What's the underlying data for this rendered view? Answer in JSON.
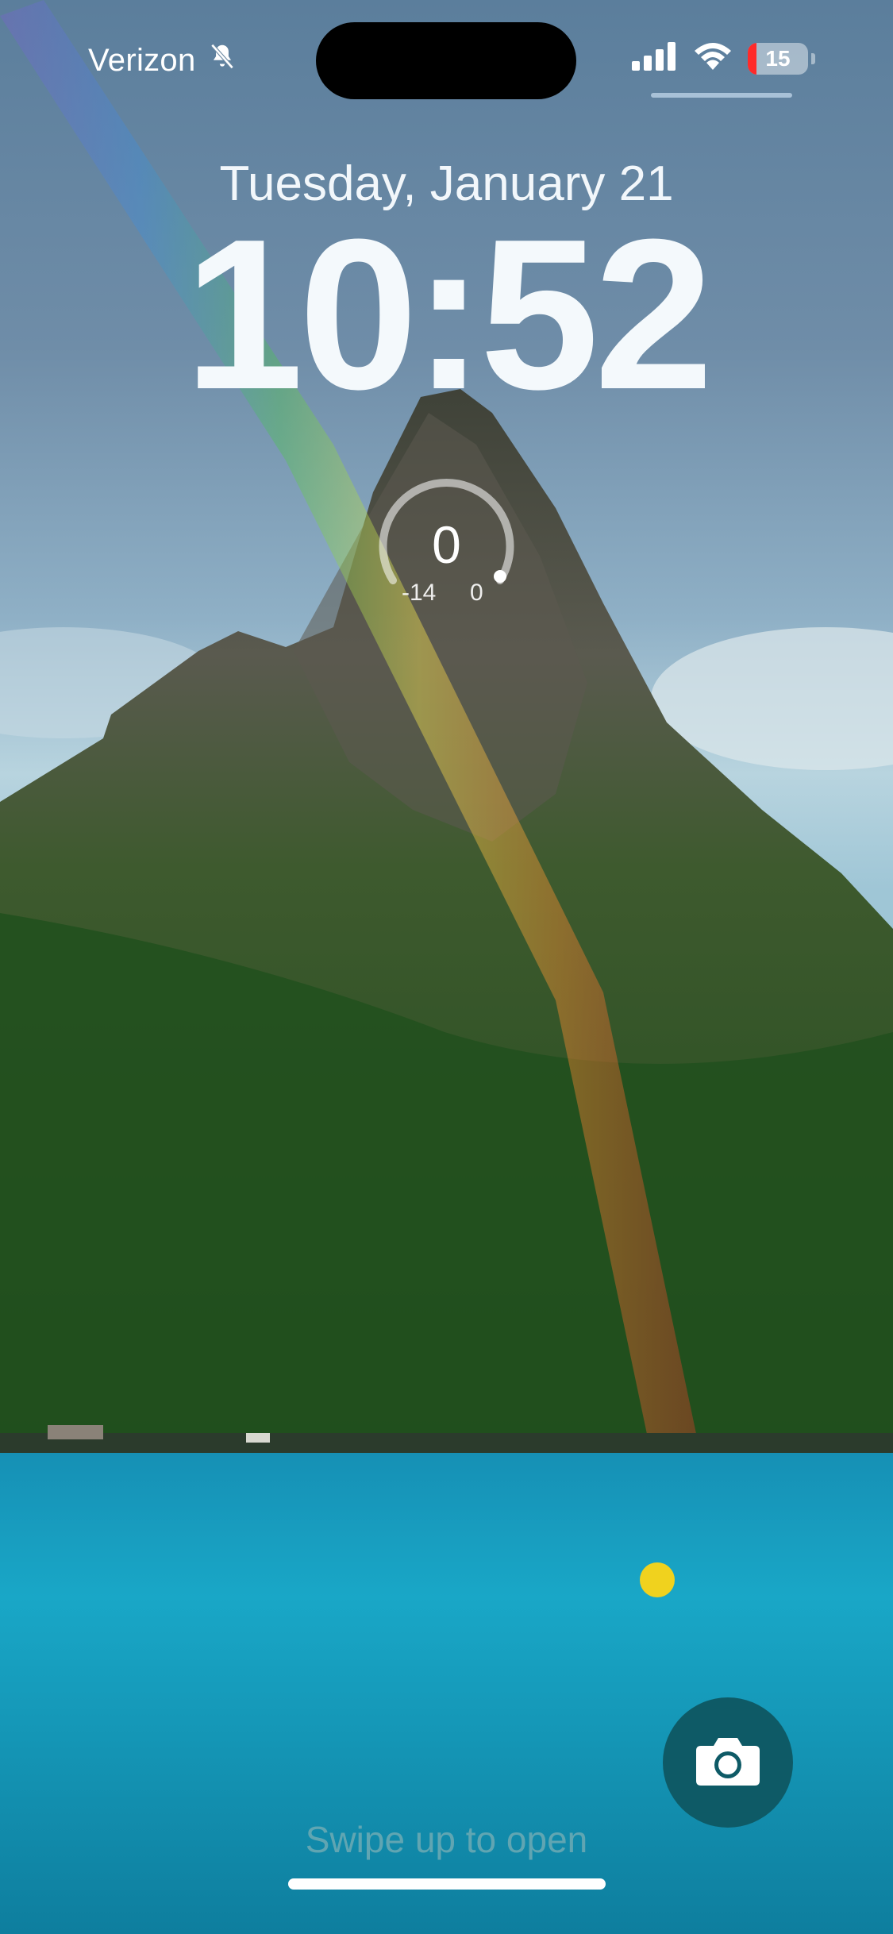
{
  "status_bar": {
    "carrier": "Verizon",
    "silent_icon": "bell-slash-icon",
    "signal_icon": "cellular-signal-icon",
    "wifi_icon": "wifi-icon",
    "battery_level": "15",
    "battery_fraction": 0.15,
    "battery_color": "#ff2a2a"
  },
  "lock_screen": {
    "date": "Tuesday, January 21",
    "time": "10:52"
  },
  "widget": {
    "value": "0",
    "min_label": "-14",
    "max_label": "0"
  },
  "controls": {
    "camera_icon": "camera-icon",
    "swipe_hint": "Swipe up to open"
  },
  "colors": {
    "camera_button": "#0e5a66",
    "water": "#17a3c4",
    "sky": "#6f8da8"
  }
}
